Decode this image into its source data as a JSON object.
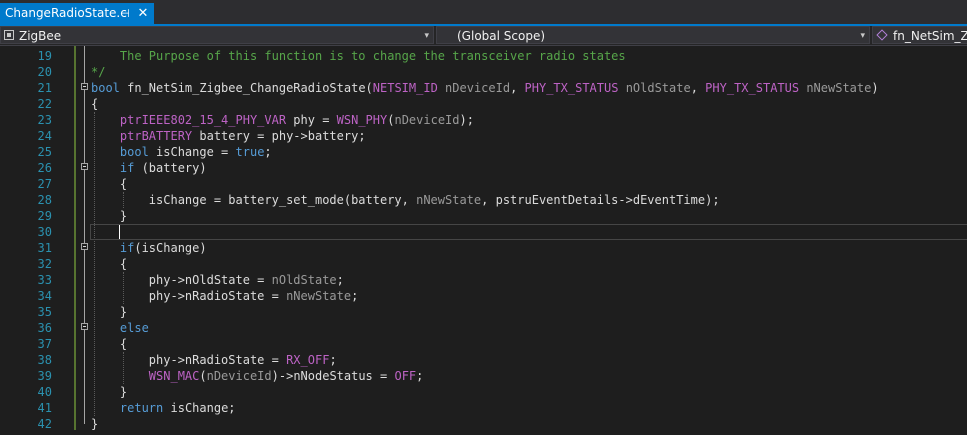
{
  "tab": {
    "title": "ChangeRadioState.c",
    "pin_glyph": "⊣",
    "close_glyph": "✕"
  },
  "navbar": {
    "project": "ZigBee",
    "scope": "(Global Scope)",
    "function": "fn_NetSim_Zigbee_ChangeRadioState",
    "dropdown_glyph": "▾"
  },
  "colors": {
    "accent": "#007acc",
    "background": "#1e1e1e",
    "line_number": "#2b91af",
    "comment": "#57a64a",
    "keyword": "#569cd6",
    "macro": "#bd63c5",
    "type": "#4ec9b0",
    "parameter": "#9a9a9a",
    "enum_value": "#b8d7a3"
  },
  "editor": {
    "caret_line": "30",
    "lines": [
      {
        "n": "19",
        "tokens": [
          {
            "t": "c",
            "s": "    The Purpose of this function is to change the transceiver radio states"
          }
        ]
      },
      {
        "n": "20",
        "tokens": [
          {
            "t": "c",
            "s": "*/"
          }
        ]
      },
      {
        "n": "21",
        "fold": true,
        "tokens": [
          {
            "t": "k",
            "s": "bool"
          },
          {
            "t": "i",
            "s": " fn_NetSim_Zigbee_ChangeRadioState("
          },
          {
            "t": "m",
            "s": "NETSIM_ID"
          },
          {
            "t": "i",
            "s": " "
          },
          {
            "t": "p",
            "s": "nDeviceId"
          },
          {
            "t": "i",
            "s": ", "
          },
          {
            "t": "m",
            "s": "PHY_TX_STATUS"
          },
          {
            "t": "i",
            "s": " "
          },
          {
            "t": "p",
            "s": "nOldState"
          },
          {
            "t": "i",
            "s": ", "
          },
          {
            "t": "m",
            "s": "PHY_TX_STATUS"
          },
          {
            "t": "i",
            "s": " "
          },
          {
            "t": "p",
            "s": "nNewState"
          },
          {
            "t": "i",
            "s": ")"
          }
        ]
      },
      {
        "n": "22",
        "tokens": [
          {
            "t": "i",
            "s": "{"
          }
        ]
      },
      {
        "n": "23",
        "tokens": [
          {
            "t": "i",
            "s": "    "
          },
          {
            "t": "m",
            "s": "ptrIEEE802_15_4_PHY_VAR"
          },
          {
            "t": "i",
            "s": " phy = "
          },
          {
            "t": "m",
            "s": "WSN_PHY"
          },
          {
            "t": "i",
            "s": "("
          },
          {
            "t": "p",
            "s": "nDeviceId"
          },
          {
            "t": "i",
            "s": ");"
          }
        ]
      },
      {
        "n": "24",
        "tokens": [
          {
            "t": "i",
            "s": "    "
          },
          {
            "t": "m",
            "s": "ptrBATTERY"
          },
          {
            "t": "i",
            "s": " battery = phy->battery;"
          }
        ]
      },
      {
        "n": "25",
        "tokens": [
          {
            "t": "i",
            "s": "    "
          },
          {
            "t": "k",
            "s": "bool"
          },
          {
            "t": "i",
            "s": " isChange = "
          },
          {
            "t": "k",
            "s": "true"
          },
          {
            "t": "i",
            "s": ";"
          }
        ]
      },
      {
        "n": "26",
        "fold": true,
        "tokens": [
          {
            "t": "i",
            "s": "    "
          },
          {
            "t": "k",
            "s": "if"
          },
          {
            "t": "i",
            "s": " (battery)"
          }
        ]
      },
      {
        "n": "27",
        "tokens": [
          {
            "t": "i",
            "s": "    {"
          }
        ]
      },
      {
        "n": "28",
        "tokens": [
          {
            "t": "i",
            "s": "        isChange = battery_set_mode(battery, "
          },
          {
            "t": "p",
            "s": "nNewState"
          },
          {
            "t": "i",
            "s": ", pstruEventDetails->dEventTime);"
          }
        ]
      },
      {
        "n": "29",
        "tokens": [
          {
            "t": "i",
            "s": "    }"
          }
        ]
      },
      {
        "n": "30",
        "tokens": []
      },
      {
        "n": "31",
        "fold": true,
        "tokens": [
          {
            "t": "i",
            "s": "    "
          },
          {
            "t": "k",
            "s": "if"
          },
          {
            "t": "i",
            "s": "(isChange)"
          }
        ]
      },
      {
        "n": "32",
        "tokens": [
          {
            "t": "i",
            "s": "    {"
          }
        ]
      },
      {
        "n": "33",
        "tokens": [
          {
            "t": "i",
            "s": "        phy->nOldState = "
          },
          {
            "t": "p",
            "s": "nOldState"
          },
          {
            "t": "i",
            "s": ";"
          }
        ]
      },
      {
        "n": "34",
        "tokens": [
          {
            "t": "i",
            "s": "        phy->nRadioState = "
          },
          {
            "t": "p",
            "s": "nNewState"
          },
          {
            "t": "i",
            "s": ";"
          }
        ]
      },
      {
        "n": "35",
        "tokens": [
          {
            "t": "i",
            "s": "    }"
          }
        ]
      },
      {
        "n": "36",
        "fold": true,
        "tokens": [
          {
            "t": "i",
            "s": "    "
          },
          {
            "t": "k",
            "s": "else"
          }
        ]
      },
      {
        "n": "37",
        "tokens": [
          {
            "t": "i",
            "s": "    {"
          }
        ]
      },
      {
        "n": "38",
        "tokens": [
          {
            "t": "i",
            "s": "        phy->nRadioState = "
          },
          {
            "t": "m",
            "s": "RX_OFF"
          },
          {
            "t": "i",
            "s": ";"
          }
        ]
      },
      {
        "n": "39",
        "tokens": [
          {
            "t": "i",
            "s": "        "
          },
          {
            "t": "m",
            "s": "WSN_MAC"
          },
          {
            "t": "i",
            "s": "("
          },
          {
            "t": "p",
            "s": "nDeviceId"
          },
          {
            "t": "i",
            "s": ")->nNodeStatus = "
          },
          {
            "t": "m",
            "s": "OFF"
          },
          {
            "t": "i",
            "s": ";"
          }
        ]
      },
      {
        "n": "40",
        "tokens": [
          {
            "t": "i",
            "s": "    }"
          }
        ]
      },
      {
        "n": "41",
        "tokens": [
          {
            "t": "i",
            "s": "    "
          },
          {
            "t": "k",
            "s": "return"
          },
          {
            "t": "i",
            "s": " isChange;"
          }
        ]
      },
      {
        "n": "42",
        "tokens": [
          {
            "t": "i",
            "s": "}"
          }
        ]
      }
    ]
  }
}
